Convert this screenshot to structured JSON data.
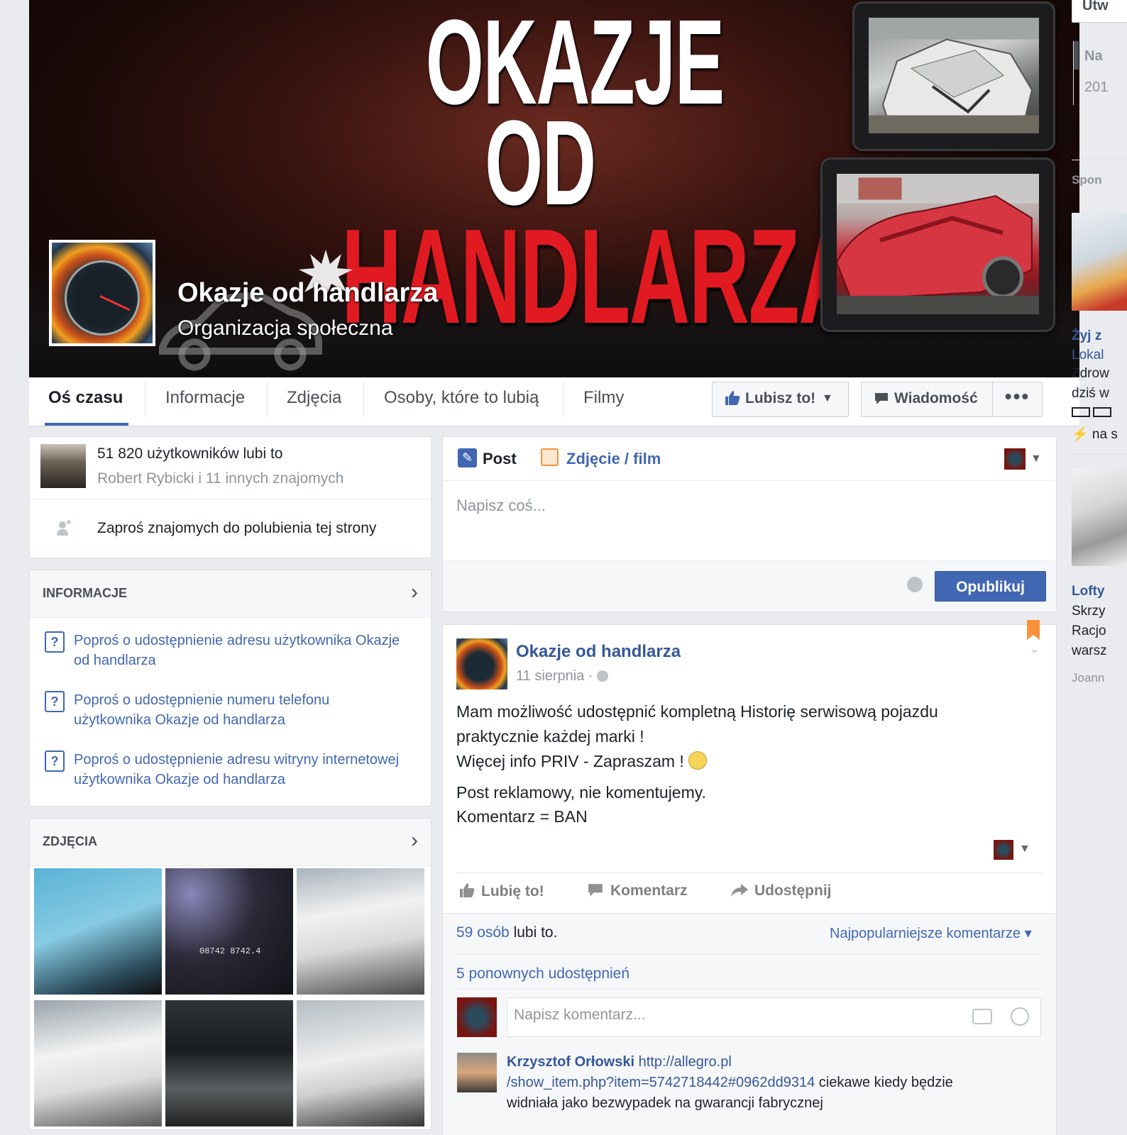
{
  "cover": {
    "title_line1": "OKAZJE",
    "title_line2": "OD",
    "title_line3": "HANDLARZA",
    "page_name": "Okazje od handlarza",
    "page_category": "Organizacja społeczna"
  },
  "nav": {
    "tabs": [
      "Oś czasu",
      "Informacje",
      "Zdjęcia",
      "Osoby, które to lubią",
      "Filmy"
    ],
    "like_button": "Lubisz to!",
    "message_button": "Wiadomość",
    "more_button": "•••"
  },
  "likes_card": {
    "count_text": "51 820 użytkowników lubi to",
    "friends_text": "Robert Rybicki i 11 innych znajomych",
    "invite_text": "Zaproś znajomych do polubienia tej strony"
  },
  "info_card": {
    "title": "INFORMACJE",
    "links": [
      "Poproś o udostępnienie adresu użytkownika Okazje od handlarza",
      "Poproś o udostępnienie numeru telefonu użytkownika Okazje od handlarza",
      "Poproś o udostępnienie adresu witryny internetowej użytkownika Okazje od handlarza"
    ]
  },
  "photos_card": {
    "title": "ZDJĘCIA",
    "dash_readout": "08742   8742.4"
  },
  "composer": {
    "post_tab": "Post",
    "photo_tab": "Zdjęcie / film",
    "placeholder": "Napisz coś...",
    "publish_button": "Opublikuj"
  },
  "post": {
    "author": "Okazje od handlarza",
    "date": "11 sierpnia · ",
    "lines": [
      "Mam możliwość udostępnić kompletną Historię serwisową pojazdu",
      "praktycznie każdej marki !",
      "Więcej info PRIV - Zapraszam ! ",
      "Post reklamowy, nie komentujemy.",
      "Komentarz = BAN"
    ],
    "actions": {
      "like": "Lubię to!",
      "comment": "Komentarz",
      "share": "Udostępnij"
    },
    "likes_count": "59 osób",
    "likes_suffix": " lubi to.",
    "top_comments": "Najpopularniejsze komentarze ▾",
    "shares": "5 ponownych udostępnień",
    "comment_placeholder": "Napisz komentarz...",
    "comment": {
      "author": "Krzysztof Orłowski",
      "link_part1": "http://allegro.pl",
      "link_part2": "/show_item.php?item=5742718442#0962dd9314",
      "text": " ciekawe kiedy będzie",
      "text2": "widniała jako bezwypadek na gwarancji fabrycznej"
    }
  },
  "right_column": {
    "top_btn": "Utw",
    "na": "Na",
    "year": "201",
    "sponsored": "Spon",
    "ad1_title": "Żyj z",
    "ad1_site": "Lokal",
    "ad1_l1": "Zdrow",
    "ad1_l2": "dziś w",
    "ad1_l4": "⚡ na s",
    "ad2_title": "Lofty",
    "ad2_l1": "Skrzy",
    "ad2_l2": "Racjo",
    "ad2_l3": "warsz",
    "ad2_l4": "Joann"
  },
  "colors": {
    "brand_blue": "#4267b2",
    "link_blue": "#365899",
    "title_red": "#e11a22",
    "page_bg": "#e9ebee"
  }
}
